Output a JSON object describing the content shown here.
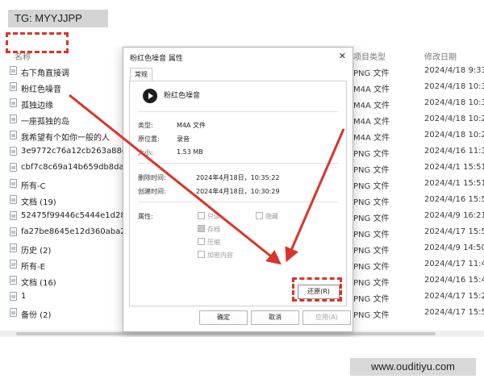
{
  "tag_label": "TG: MYYJJPP",
  "watermark": "www.ouditiyu.com",
  "columns": {
    "name": "名称",
    "type": "项目类型",
    "date": "修改日期"
  },
  "files": [
    {
      "name": "右下角直接调",
      "type": "PNG 文件",
      "date": "2024/4/18 9:33"
    },
    {
      "name": "粉红色噪音",
      "type": "M4A 文件",
      "date": "2024/4/18 10:31"
    },
    {
      "name": "孤独边缘",
      "type": "M4A 文件",
      "date": "2024/4/18 10:31"
    },
    {
      "name": "一座孤独的岛",
      "type": "M4A 文件",
      "date": "2024/4/18 10:29"
    },
    {
      "name": "我希望有个如你一般的人",
      "type": "M4A 文件",
      "date": "2024/4/18 10:29"
    },
    {
      "name": "3e9772c76a12cb263a88dc603ec2",
      "type": "PNG 文件",
      "date": "2024/4/16 11:38"
    },
    {
      "name": "cbf7c8c69a14b659db8daa0dae0b",
      "type": "PNG 文件",
      "date": "2024/4/1 15:51"
    },
    {
      "name": "所有-C",
      "type": "PNG 文件",
      "date": "2024/4/1 15:51"
    },
    {
      "name": "文档 (19)",
      "type": "PNG 文件",
      "date": "2024/4/16 15:51"
    },
    {
      "name": "52475f99446c5444e1d285bc5547",
      "type": "PNG 文件",
      "date": "2024/4/9 16:21"
    },
    {
      "name": "fa27be8645e12d360aba23242e16",
      "type": "PNG 文件",
      "date": "2024/4/17 15:51"
    },
    {
      "name": "历史 (2)",
      "type": "PNG 文件",
      "date": "2024/4/9 14:50"
    },
    {
      "name": "所有-E",
      "type": "PNG 文件",
      "date": "2024/4/17 11:47"
    },
    {
      "name": "文档 (16)",
      "type": "PNG 文件",
      "date": "2024/4/16 15:48"
    },
    {
      "name": "1",
      "type": "PNG 文件",
      "date": "2024/4/17 15:28"
    },
    {
      "name": "备份 (2)",
      "type": "PNG 文件",
      "date": "2024/4/17 15:51"
    }
  ],
  "dialog": {
    "title": "粉红色噪音 属性",
    "close_glyph": "✕",
    "tab": "常规",
    "file_name": "粉红色噪音",
    "info": [
      {
        "label": "类型:",
        "value": "M4A 文件"
      },
      {
        "label": "原位置:",
        "value": "录音"
      },
      {
        "label": "大小:",
        "value": "1.53 MB"
      }
    ],
    "dates": [
      {
        "label": "删除时间:",
        "value": "2024年4月18日，10:35:22"
      },
      {
        "label": "创建时间:",
        "value": "2024年4月18日，10:30:29"
      }
    ],
    "attributes_label": "属性:",
    "attributes": {
      "readonly": "只读",
      "hidden": "隐藏",
      "archive": "存档",
      "compress": "压缩",
      "encrypt": "加密内容"
    },
    "restore_button": "还原(R)",
    "ok_button": "确定",
    "cancel_button": "取消",
    "apply_button": "应用(A)"
  },
  "colors": {
    "highlight": "#d9352a",
    "tag_bg": "#d4d4d4"
  }
}
